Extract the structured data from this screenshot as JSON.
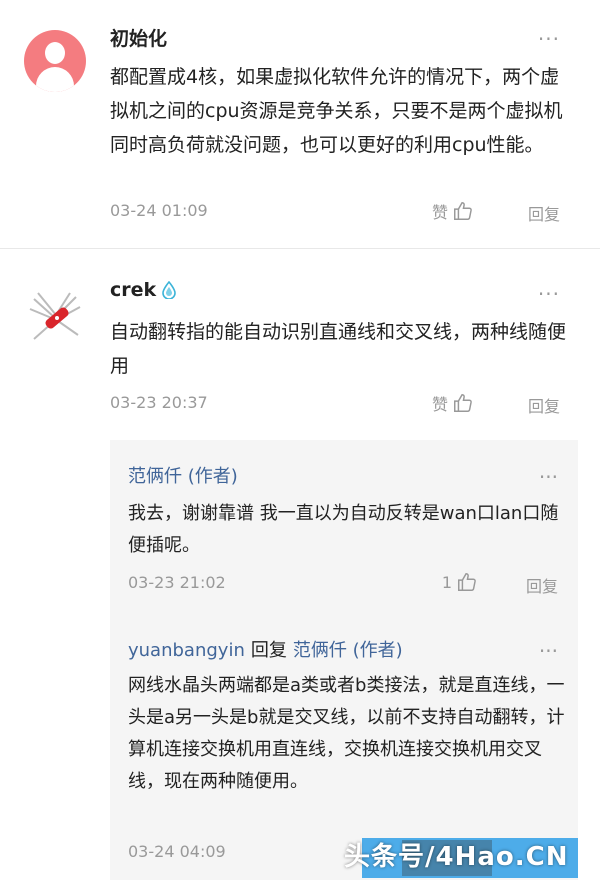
{
  "comments": [
    {
      "name": "初始化",
      "text": "都配置成4核，如果虚拟化软件允许的情况下，两个虚拟机之间的cpu资源是竞争关系，只要不是两个虚拟机同时高负荷就没问题，也可以更好的利用cpu性能。",
      "time": "03-24 01:09",
      "like_label": "赞",
      "reply_label": "回复",
      "more": "···"
    },
    {
      "name": "crek",
      "text": "自动翻转指的能自动识别直通线和交叉线，两种线随便用",
      "time": "03-23 20:37",
      "like_label": "赞",
      "reply_label": "回复",
      "more": "···"
    }
  ],
  "replies": [
    {
      "name": "范俩仟 (作者)",
      "text": "我去，谢谢靠谱 我一直以为自动反转是wan口lan口随便插呢。",
      "time": "03-23 21:02",
      "like_count": "1",
      "reply_label": "回复",
      "more": "···"
    },
    {
      "name": "yuanbangyin",
      "reply_word": "回复",
      "reply_to": "范俩仟 (作者)",
      "text": "网线水晶头两端都是a类或者b类接法，就是直连线，一头是a另一头是b就是交叉线，以前不支持自动翻转，计算机连接交换机用直连线，交换机连接交换机用交叉线，现在两种随便用。",
      "time": "03-24 04:09",
      "more": "···"
    }
  ],
  "watermark": "头条号/4Hao.CN",
  "colors": {
    "author_link": "#406599",
    "meta": "#999999",
    "avatar_default": "#f47c80"
  },
  "icons": {
    "like": "thumbs-up-icon",
    "verified": "water-drop-icon"
  }
}
